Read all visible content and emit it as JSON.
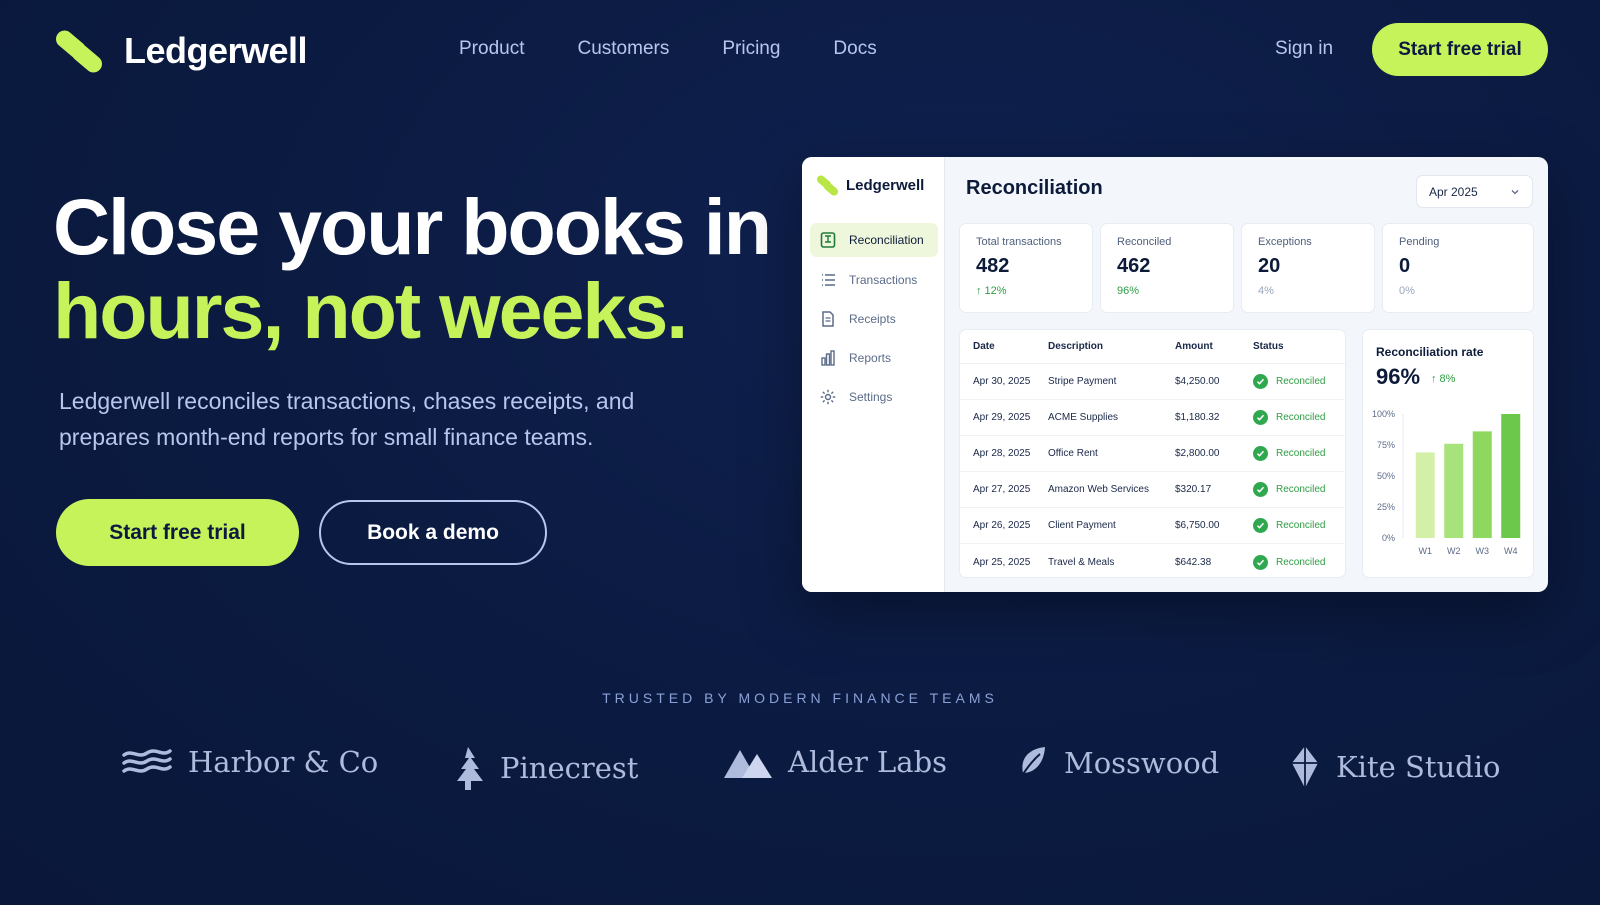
{
  "nav": {
    "logo": "Ledgerwell",
    "links": [
      "Product",
      "Customers",
      "Pricing",
      "Docs"
    ],
    "signin": "Sign in",
    "cta": "Start free trial"
  },
  "hero": {
    "title_line1": "Close your books in",
    "title_line2": "hours, not weeks.",
    "subtitle": "Ledgerwell reconciles transactions, chases receipts, and prepares month-end reports for small finance teams.",
    "primary_cta": "Start free trial",
    "secondary_cta": "Book a demo"
  },
  "dashboard": {
    "logo": "Ledgerwell",
    "sidebar": [
      {
        "label": "Reconciliation",
        "icon": "reconciliation-icon",
        "active": true
      },
      {
        "label": "Transactions",
        "icon": "list-icon",
        "active": false
      },
      {
        "label": "Receipts",
        "icon": "receipt-icon",
        "active": false
      },
      {
        "label": "Reports",
        "icon": "bar-chart-icon",
        "active": false
      },
      {
        "label": "Settings",
        "icon": "gear-icon",
        "active": false
      }
    ],
    "title": "Reconciliation",
    "month": "Apr 2025",
    "stats": [
      {
        "label": "Total transactions",
        "value": "482",
        "delta": "↑ 12%",
        "positive": true
      },
      {
        "label": "Reconciled",
        "value": "462",
        "delta": "96%",
        "positive": true
      },
      {
        "label": "Exceptions",
        "value": "20",
        "delta": "4%",
        "positive": false
      },
      {
        "label": "Pending",
        "value": "0",
        "delta": "0%",
        "positive": false
      }
    ],
    "table": {
      "headers": [
        "Date",
        "Description",
        "Amount",
        "Status"
      ],
      "rows": [
        {
          "date": "Apr 30, 2025",
          "desc": "Stripe Payment",
          "amount": "$4,250.00",
          "status": "Reconciled"
        },
        {
          "date": "Apr 29, 2025",
          "desc": "ACME Supplies",
          "amount": "$1,180.32",
          "status": "Reconciled"
        },
        {
          "date": "Apr 28, 2025",
          "desc": "Office Rent",
          "amount": "$2,800.00",
          "status": "Reconciled"
        },
        {
          "date": "Apr 27, 2025",
          "desc": "Amazon Web Services",
          "amount": "$320.17",
          "status": "Reconciled"
        },
        {
          "date": "Apr 26, 2025",
          "desc": "Client Payment",
          "amount": "$6,750.00",
          "status": "Reconciled"
        },
        {
          "date": "Apr 25, 2025",
          "desc": "Travel & Meals",
          "amount": "$642.38",
          "status": "Reconciled"
        }
      ]
    },
    "rate": {
      "title": "Reconciliation rate",
      "value": "96%",
      "delta": "↑ 8%"
    }
  },
  "chart_data": {
    "type": "bar",
    "title": "Reconciliation rate",
    "categories": [
      "W1",
      "W2",
      "W3",
      "W4"
    ],
    "values": [
      69,
      76,
      86,
      100
    ],
    "yticks": [
      "100%",
      "75%",
      "50%",
      "25%",
      "0%"
    ],
    "ylim": [
      0,
      100
    ],
    "colors": [
      "#d4f0a8",
      "#a8e27a",
      "#8fd85e",
      "#6cc84a"
    ]
  },
  "trusted": {
    "label": "TRUSTED BY MODERN FINANCE TEAMS",
    "brands": [
      {
        "name": "Harbor & Co",
        "icon": "waves-icon"
      },
      {
        "name": "Pinecrest",
        "icon": "pine-tree-icon"
      },
      {
        "name": "Alder Labs",
        "icon": "mountain-icon"
      },
      {
        "name": "Mosswood",
        "icon": "leaf-icon"
      },
      {
        "name": "Kite Studio",
        "icon": "kite-icon"
      }
    ]
  },
  "colors": {
    "background": "#0b1a40",
    "accent": "#c6f25a",
    "muted_text": "#b8c6ee",
    "success": "#2f9e44"
  }
}
